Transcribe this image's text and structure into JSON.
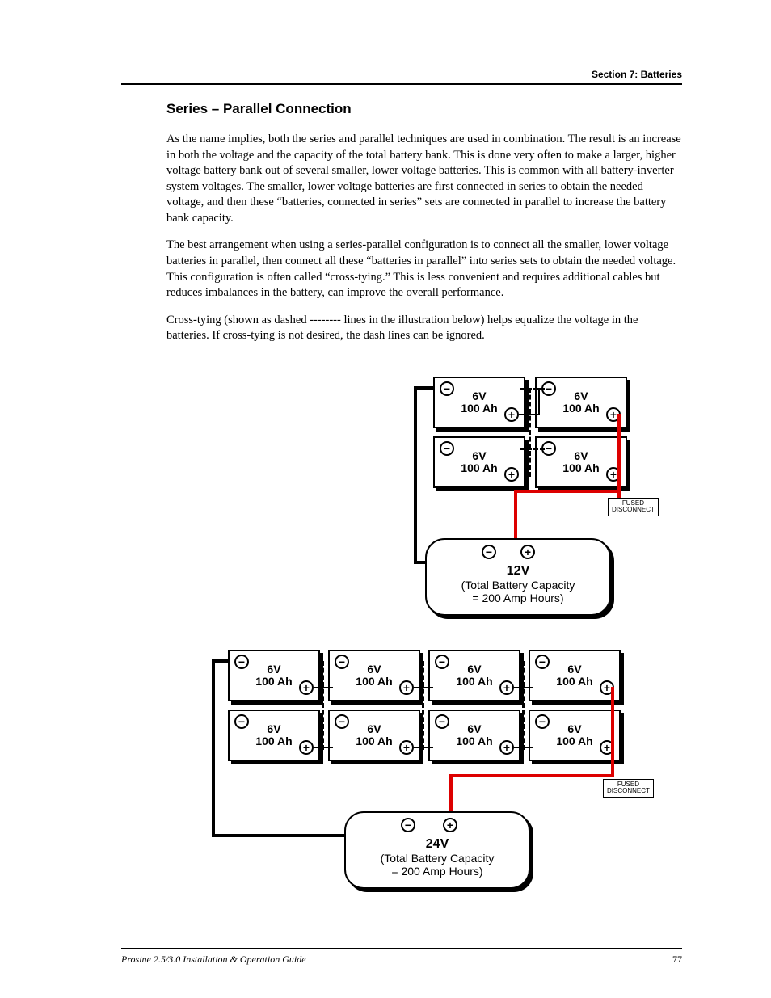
{
  "header": {
    "section_label": "Section 7: Batteries"
  },
  "heading": "Series – Parallel Connection",
  "paragraphs": {
    "p1": "As the name implies, both the series and parallel techniques are used in combination. The result is an increase in both the voltage and the capacity of the total battery bank. This is done very often to make a larger, higher voltage battery bank out of several smaller, lower voltage batteries. This is common with all battery-inverter system voltages. The smaller, lower voltage batteries are first connected in series to obtain the needed voltage, and then these “batteries, connected in series” sets are connected in parallel to increase the battery bank capacity.",
    "p2": "The best arrangement when using a series-parallel configuration is to connect all the smaller, lower voltage batteries in parallel, then connect all these “batteries in parallel” into series sets to obtain the needed voltage. This configuration is often called “cross-tying.” This is less convenient and requires additional cables but reduces imbalances in the battery, can improve the overall performance.",
    "p3": "Cross-tying (shown as dashed -------- lines in the illustration below) helps equalize the voltage in the batteries. If cross-tying is not desired, the dash lines can be ignored."
  },
  "diagrams": {
    "d12v": {
      "cell_label_line1": "6V",
      "cell_label_line2": "100 Ah",
      "fused": "FUSED\nDISCONNECT",
      "load_v": "12V",
      "load_cap": "(Total Battery Capacity\n= 200 Amp Hours)"
    },
    "d24v": {
      "cell_label_line1": "6V",
      "cell_label_line2": "100 Ah",
      "fused": "FUSED\nDISCONNECT",
      "load_v": "24V",
      "load_cap": "(Total Battery Capacity\n= 200 Amp Hours)"
    }
  },
  "symbols": {
    "minus": "−",
    "plus": "+"
  },
  "footer": {
    "guide": "Prosine 2.5/3.0 Installation & Operation Guide",
    "page": "77"
  }
}
